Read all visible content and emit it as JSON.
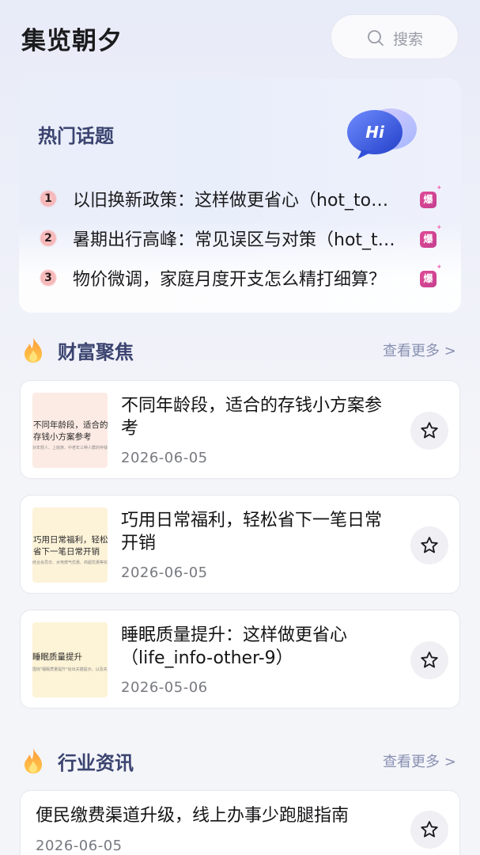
{
  "header": {
    "app_title": "集览朝夕",
    "search_label": "搜索"
  },
  "hot_topics": {
    "title": "热门话题",
    "badge_text": "Hi",
    "items": [
      {
        "rank": "1",
        "text": "以旧换新政策：这样做更省心（hot_to…",
        "tag": "爆"
      },
      {
        "rank": "2",
        "text": "暑期出行高峰：常见误区与对策（hot_t…",
        "tag": "爆"
      },
      {
        "rank": "3",
        "text": "物价微调，家庭月度开支怎么精打细算？",
        "tag": "爆"
      }
    ]
  },
  "wealth": {
    "title": "财富聚焦",
    "more": "查看更多 >",
    "articles": [
      {
        "title": "不同年龄段，适合的存钱小方案参考",
        "date": "2026-06-05",
        "thumb_title": "不同年龄段，适合的存钱小方案参考",
        "thumb_sub": "对年轻人、上班族、中老年三种人群的存钱小建议。"
      },
      {
        "title": "巧用日常福利，轻松省下一笔日常开销",
        "date": "2026-06-05",
        "thumb_title": "巧用日常福利，轻松省下一笔日常开销",
        "thumb_sub": "结合会员日、水电燃气优惠、商超优惠等实用指南。"
      },
      {
        "title": "睡眠质量提升：这样做更省心（life_info-other-9）",
        "date": "2026-05-06",
        "thumb_title": "睡眠质量提升",
        "thumb_sub": "围绕\"睡眠质量提升\"给出关键提示，以及实用的方法。"
      }
    ]
  },
  "industry": {
    "title": "行业资讯",
    "more": "查看更多 >",
    "articles": [
      {
        "title": "便民缴费渠道升级，线上办事少跑腿指南",
        "date": "2026-06-05"
      }
    ]
  },
  "colors": {
    "accent_title": "#3b4470",
    "hot_tag": "#d2458f",
    "more_link": "#8990b2"
  }
}
